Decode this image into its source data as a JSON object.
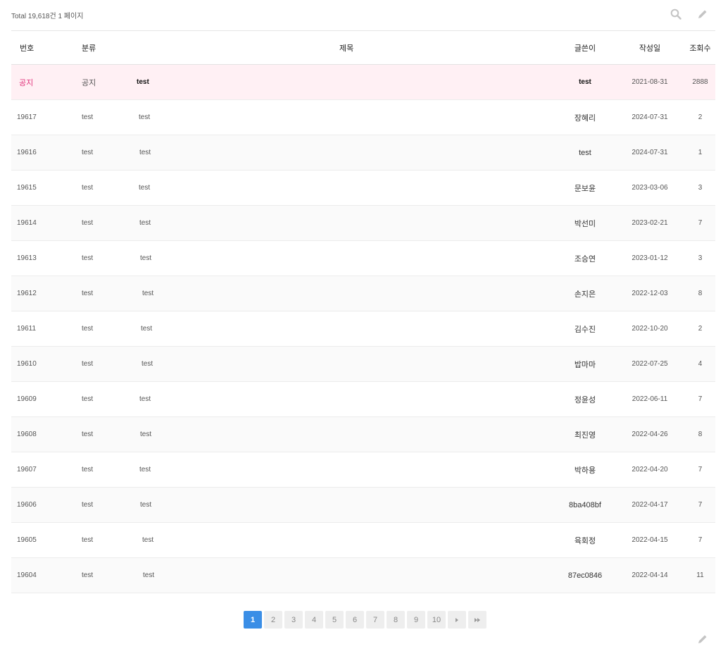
{
  "header": {
    "total_text": "Total 19,618건 1 페이지",
    "search_icon": "search-icon",
    "write_icon": "pencil-icon"
  },
  "columns": {
    "num": "번호",
    "category": "분류",
    "title": "제목",
    "writer": "글쓴이",
    "date": "작성일",
    "views": "조회수"
  },
  "notice": {
    "num": "공지",
    "category": "공지",
    "title": "test",
    "writer": "test",
    "date": "2021-08-31",
    "views": "2888"
  },
  "rows": [
    {
      "num": "19617",
      "category": "test",
      "title": "test",
      "writer": "장혜리",
      "date": "2024-07-31",
      "views": "2"
    },
    {
      "num": "19616",
      "category": "test",
      "title": "test",
      "writer": "test",
      "date": "2024-07-31",
      "views": "1"
    },
    {
      "num": "19615",
      "category": "test",
      "title": "test",
      "writer": "문보윤",
      "date": "2023-03-06",
      "views": "3"
    },
    {
      "num": "19614",
      "category": "test",
      "title": "test",
      "writer": "박선미",
      "date": "2023-02-21",
      "views": "7"
    },
    {
      "num": "19613",
      "category": "test",
      "title": "test",
      "writer": "조승연",
      "date": "2023-01-12",
      "views": "3"
    },
    {
      "num": "19612",
      "category": "test",
      "title": "test",
      "writer": "손지은",
      "date": "2022-12-03",
      "views": "8"
    },
    {
      "num": "19611",
      "category": "test",
      "title": "test",
      "writer": "김수진",
      "date": "2022-10-20",
      "views": "2"
    },
    {
      "num": "19610",
      "category": "test",
      "title": "test",
      "writer": "밥마마",
      "date": "2022-07-25",
      "views": "4"
    },
    {
      "num": "19609",
      "category": "test",
      "title": "test",
      "writer": "정윤성",
      "date": "2022-06-11",
      "views": "7"
    },
    {
      "num": "19608",
      "category": "test",
      "title": "test",
      "writer": "최진영",
      "date": "2022-04-26",
      "views": "8"
    },
    {
      "num": "19607",
      "category": "test",
      "title": "test",
      "writer": "박하용",
      "date": "2022-04-20",
      "views": "7"
    },
    {
      "num": "19606",
      "category": "test",
      "title": "test",
      "writer": "8ba408bf",
      "date": "2022-04-17",
      "views": "7"
    },
    {
      "num": "19605",
      "category": "test",
      "title": "test",
      "writer": "육회정",
      "date": "2022-04-15",
      "views": "7"
    },
    {
      "num": "19604",
      "category": "test",
      "title": "test",
      "writer": "87ec0846",
      "date": "2022-04-14",
      "views": "11"
    }
  ],
  "pagination": {
    "pages": [
      "1",
      "2",
      "3",
      "4",
      "5",
      "6",
      "7",
      "8",
      "9",
      "10"
    ],
    "current": "1",
    "next_icon": "next-page-icon",
    "last_icon": "last-page-icon"
  },
  "colors": {
    "accent": "#3a8ee6",
    "notice_bg": "#fff0f4",
    "notice_text": "#e0327a"
  }
}
